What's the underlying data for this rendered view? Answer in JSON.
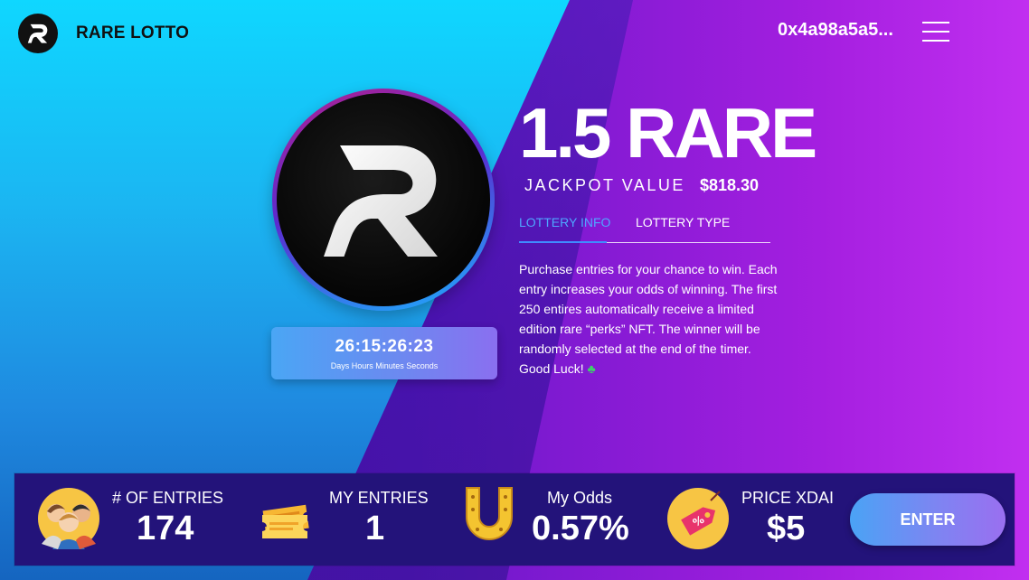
{
  "header": {
    "app_title": "RARE LOTTO",
    "wallet": "0x4a98a5a5...",
    "logo_icon": "rare-r-logo-icon",
    "menu_icon": "hamburger-menu-icon"
  },
  "jackpot": {
    "amount": "1.5 RARE",
    "label": "JACKPOT VALUE",
    "usd_value": "$818.30"
  },
  "timer": {
    "value": "26:15:26:23",
    "caption": "Days Hours Minutes Seconds"
  },
  "tabs": [
    {
      "label": "LOTTERY INFO",
      "active": true
    },
    {
      "label": "LOTTERY TYPE",
      "active": false
    }
  ],
  "description": "Purchase entries for your chance to win. Each entry increases your odds of winning. The first 250 entires automatically receive a limited edition rare “perks” NFT. The winner will be randomly selected at the end of the timer. Good Luck!",
  "stats": [
    {
      "label": "# OF ENTRIES",
      "value": "174",
      "icon": "people-group-icon"
    },
    {
      "label": "MY ENTRIES",
      "value": "1",
      "icon": "ticket-icon"
    },
    {
      "label": "My Odds",
      "value": "0.57%",
      "icon": "horseshoe-icon"
    },
    {
      "label": "PRICE XDAI",
      "value": "$5",
      "icon": "price-tag-icon"
    }
  ],
  "enter_button": "ENTER",
  "colors": {
    "accent_blue": "#3f8cff",
    "bar_bg": "#23137a",
    "left_bg": "#1bb6f2",
    "right_bg": "#a51fe0"
  }
}
